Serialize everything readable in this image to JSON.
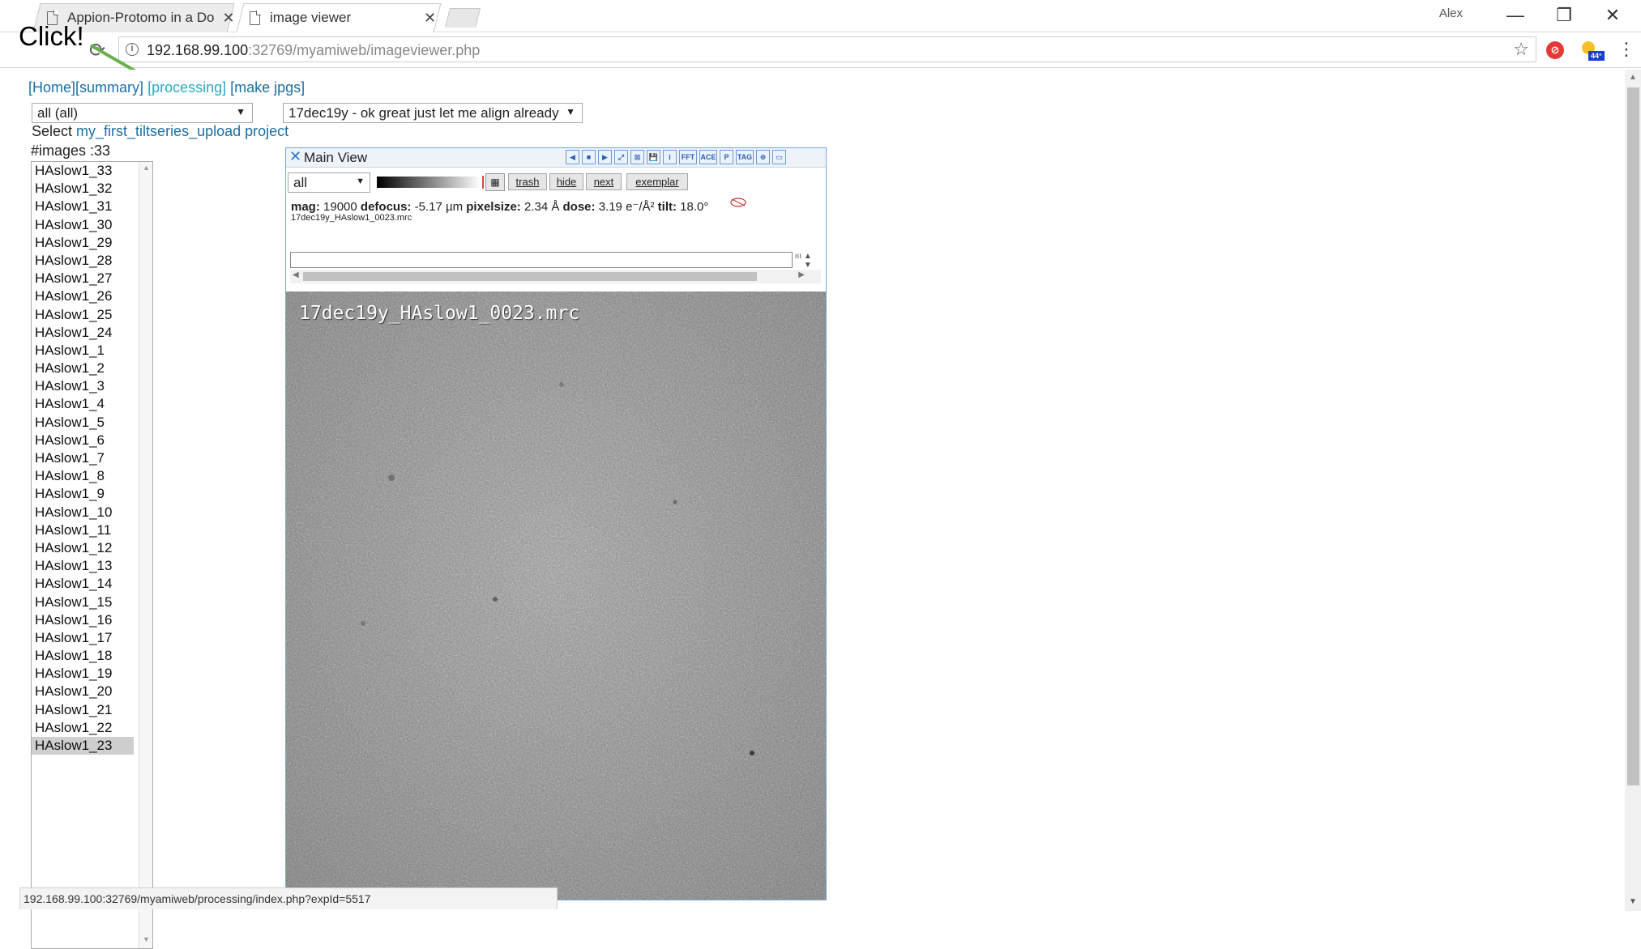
{
  "browser": {
    "tabs": [
      {
        "title": "Appion-Protomo in a Do"
      },
      {
        "title": "image viewer"
      }
    ],
    "profile_name": "Alex",
    "url_host": "192.168.99.100",
    "url_rest": ":32769/myamiweb/imageviewer.php",
    "weather_badge": "44°"
  },
  "annotation": {
    "click_label": "Click!"
  },
  "nav": {
    "home": "[Home]",
    "summary": "[summary]",
    "processing": "[processing]",
    "make_jpgs": "[make jpgs]"
  },
  "filters": {
    "group_select": "all (all)",
    "session_select": "17dec19y - ok great just let me align already"
  },
  "project": {
    "prefix": "Select",
    "link": "my_first_tiltseries_upload project"
  },
  "image_count": "#images :33",
  "images": [
    "HAslow1_33",
    "HAslow1_32",
    "HAslow1_31",
    "HAslow1_30",
    "HAslow1_29",
    "HAslow1_28",
    "HAslow1_27",
    "HAslow1_26",
    "HAslow1_25",
    "HAslow1_24",
    "HAslow1_1",
    "HAslow1_2",
    "HAslow1_3",
    "HAslow1_4",
    "HAslow1_5",
    "HAslow1_6",
    "HAslow1_7",
    "HAslow1_8",
    "HAslow1_9",
    "HAslow1_10",
    "HAslow1_11",
    "HAslow1_12",
    "HAslow1_13",
    "HAslow1_14",
    "HAslow1_15",
    "HAslow1_16",
    "HAslow1_17",
    "HAslow1_18",
    "HAslow1_19",
    "HAslow1_20",
    "HAslow1_21",
    "HAslow1_22",
    "HAslow1_23"
  ],
  "selected_image": "HAslow1_23",
  "main_view": {
    "title": "Main View",
    "filter_select": "all",
    "buttons": {
      "trash": "trash",
      "hide": "hide",
      "next": "next",
      "exemplar": "exemplar"
    },
    "tools": [
      "◀",
      "■",
      "▶",
      "⤢",
      "⊠",
      "💾",
      "i",
      "FFT",
      "ACE",
      "P",
      "TAG",
      "⊕",
      "▭"
    ],
    "info": {
      "mag_label": "mag:",
      "mag": "19000",
      "defocus_label": "defocus:",
      "defocus": "-5.17 µm",
      "pixelsize_label": "pixelsize:",
      "pixelsize": "2.34 Å",
      "dose_label": "dose:",
      "dose": "3.19 e⁻/Å²",
      "tilt_label": "tilt:",
      "tilt": "18.0°"
    },
    "filename": "17dec19y_HAslow1_0023.mrc",
    "overlay_filename": "17dec19y_HAslow1_0023.mrc"
  },
  "status_url": "192.168.99.100:32769/myamiweb/processing/index.php?expId=5517",
  "colors": {
    "link": "#1a6fa5",
    "processing_link": "#2aa8c6",
    "arrow": "#6ab04c",
    "panel_border": "#7aa7d6"
  }
}
